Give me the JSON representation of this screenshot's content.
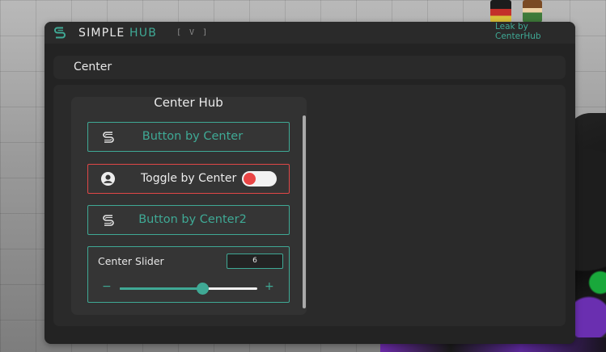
{
  "window": {
    "title_main": "SIMPLE",
    "title_accent": "HUB",
    "version": "[ V ]",
    "leak_line1": "Leak by",
    "leak_line2": "CenterHub"
  },
  "tabbar": {
    "tab_label": "Center"
  },
  "section": {
    "title": "Center Hub",
    "button1": {
      "label": "Button by Center",
      "icon": "s-logo-icon"
    },
    "toggle": {
      "label": "Toggle by Center",
      "icon": "user-circle-icon",
      "state": "off"
    },
    "button2": {
      "label": "Button by Center2",
      "icon": "s-logo-icon"
    },
    "slider": {
      "label": "Center Slider",
      "value": "6",
      "minus": "−",
      "plus": "+",
      "fraction": 0.6
    }
  },
  "colors": {
    "accent": "#3fa995",
    "toggle_red": "#e94545",
    "panel": "#232323"
  }
}
